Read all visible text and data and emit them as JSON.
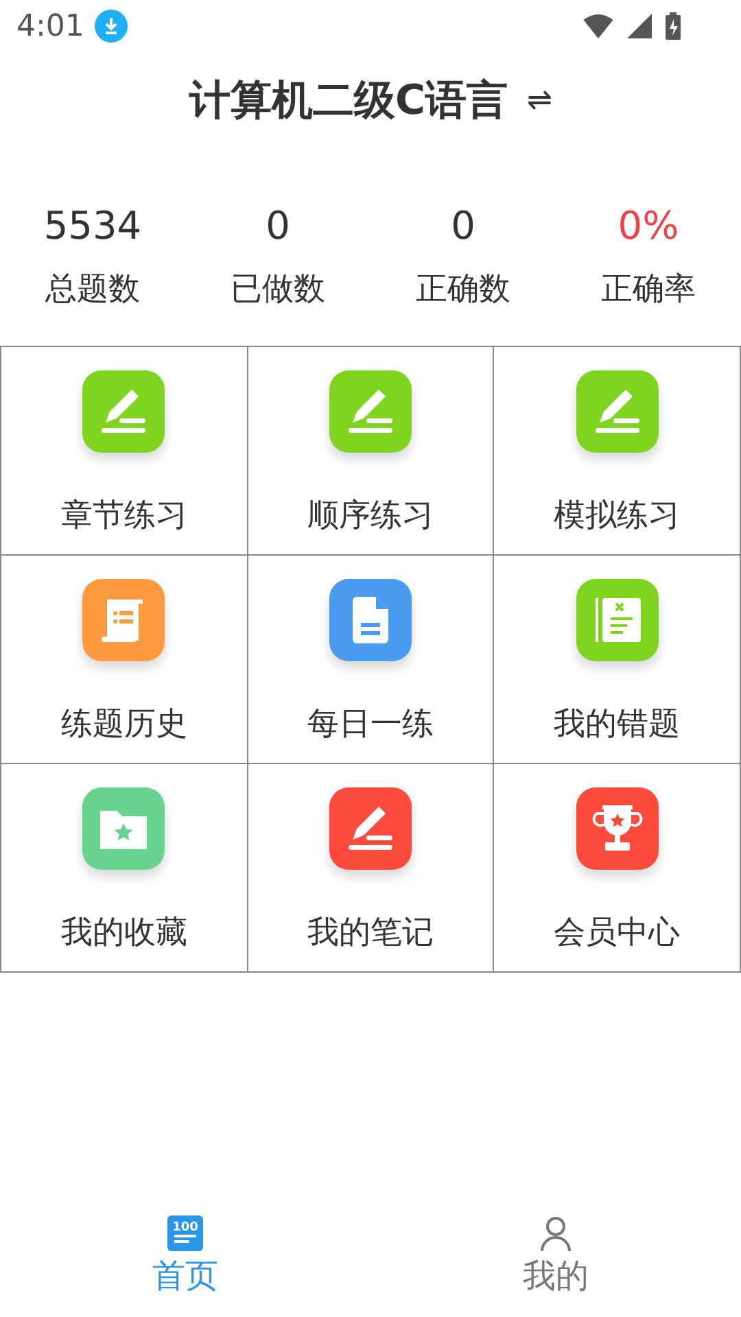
{
  "status_bar": {
    "time": "4:01"
  },
  "header": {
    "title": "计算机二级C语言",
    "switch_glyph": "⇌"
  },
  "stats": [
    {
      "value": "5534",
      "label": "总题数",
      "color": "#333333"
    },
    {
      "value": "0",
      "label": "已做数",
      "color": "#333333"
    },
    {
      "value": "0",
      "label": "正确数",
      "color": "#333333"
    },
    {
      "value": "0%",
      "label": "正确率",
      "color": "#f0404a"
    }
  ],
  "menu": [
    {
      "label": "章节练习",
      "kind": "pencil",
      "color": "#7fd41f"
    },
    {
      "label": "顺序练习",
      "kind": "pencil",
      "color": "#7fd41f"
    },
    {
      "label": "模拟练习",
      "kind": "pencil",
      "color": "#7fd41f"
    },
    {
      "label": "练题历史",
      "kind": "scroll",
      "color": "#fd9a3e"
    },
    {
      "label": "每日一练",
      "kind": "document",
      "color": "#4a9af0"
    },
    {
      "label": "我的错题",
      "kind": "book",
      "color": "#7fd41f"
    },
    {
      "label": "我的收藏",
      "kind": "folder",
      "color": "#67d38f"
    },
    {
      "label": "我的笔记",
      "kind": "pencil",
      "color": "#fb4a3b"
    },
    {
      "label": "会员中心",
      "kind": "trophy",
      "color": "#fb4a3b"
    }
  ],
  "bottom_nav": [
    {
      "label": "首页",
      "kind": "home",
      "icon_text": "100",
      "selected": true
    },
    {
      "label": "我的",
      "kind": "person",
      "selected": false
    }
  ]
}
